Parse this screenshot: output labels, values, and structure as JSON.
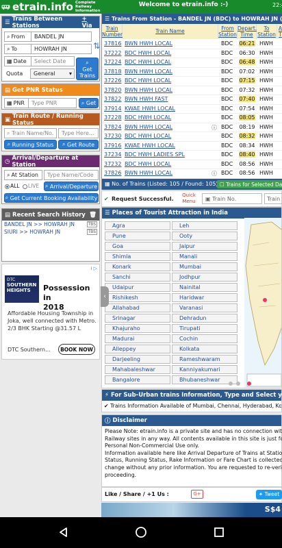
{
  "header": {
    "logo_text": "etrain.info",
    "tagline": "Complete Railway Information",
    "welcome": "Welcome to etrain.info :-)",
    "clock": "22:4"
  },
  "between_stations": {
    "title": "Trains Between Stations",
    "via": "+ Via",
    "from_label": "From",
    "from_value": "BANDEL JN",
    "to_label": "To",
    "to_value": "HOWRAH JN",
    "date_label": "Date",
    "date_placeholder": "Select Date",
    "quota_label": "Quota",
    "quota_value": "General",
    "get_trains": "Get Trains"
  },
  "pnr": {
    "title": "Get PNR Status",
    "label": "PNR",
    "placeholder": "Type PNR",
    "button": "Get"
  },
  "route": {
    "title": "Train Route / Running Status",
    "placeholder_1": "Train Name/No.",
    "placeholder_2": "Type Here...",
    "running_btn": "Running Status",
    "route_btn": "Get Route"
  },
  "arrdep": {
    "title": "Arrival/Departure at Station",
    "station_label": "At Station",
    "station_placeholder": "Type Name/Code",
    "radio_all": "ALL",
    "radio_live": "LIVE",
    "arrdep_btn": "Arrival/Departure",
    "booking_btn": "Get Current Booking Availability"
  },
  "history": {
    "title": "Recent Search History",
    "items": [
      {
        "text": "BANDEL JN >> HOWRAH JN",
        "tag": "TBS"
      },
      {
        "text": "SIURI >> HOWRAH JN",
        "tag": "TBS"
      }
    ]
  },
  "ad": {
    "choice": "i ▷",
    "logo_line1": "DTC",
    "logo_line2": "SOUTHERN",
    "logo_line3": "HEIGHTS",
    "title_line1": "Possession in",
    "title_line2": "2018",
    "desc": "Affordable Housing Township in Joka, well connected with Metro. 2/3 BHK Starting @31.57 L",
    "source": "DTC Southern...",
    "cta": "BOOK NOW"
  },
  "trains": {
    "title": "Trains From Station - BANDEL JN (BDC) to HOWRAH JN (HWH)",
    "columns": [
      "Train Number",
      "Train Name",
      "From Station",
      "Depart. Time",
      "To Station",
      "A T"
    ],
    "rows": [
      {
        "num": "37816",
        "name": "BWN HWH LOCAL",
        "from": "BDC",
        "dep": "06:21",
        "to": "HWH",
        "hl": true,
        "info": false
      },
      {
        "num": "37222",
        "name": "BDC HWH LOCAL",
        "from": "BDC",
        "dep": "06:30",
        "to": "HWH",
        "hl": false,
        "info": false
      },
      {
        "num": "37224",
        "name": "BDC HWH LOCAL",
        "from": "BDC",
        "dep": "06:48",
        "to": "HWH",
        "hl": true,
        "info": false
      },
      {
        "num": "37818",
        "name": "BWN HWH LOCAL",
        "from": "BDC",
        "dep": "07:02",
        "to": "HWH",
        "hl": false,
        "info": false
      },
      {
        "num": "37226",
        "name": "BDC HWH LOCAL",
        "from": "BDC",
        "dep": "07:15",
        "to": "HWH",
        "hl": true,
        "info": false
      },
      {
        "num": "37820",
        "name": "BWN HWH LOCAL",
        "from": "BDC",
        "dep": "07:32",
        "to": "HWH",
        "hl": false,
        "info": false
      },
      {
        "num": "37822",
        "name": "BWN HWH FAST",
        "from": "BDC",
        "dep": "07:40",
        "to": "HWH",
        "hl": true,
        "info": false
      },
      {
        "num": "37914",
        "name": "KWAE HWH LOCAL",
        "from": "BDC",
        "dep": "07:54",
        "to": "HWH",
        "hl": false,
        "info": false
      },
      {
        "num": "37228",
        "name": "BDC HWH LOCAL",
        "from": "BDC",
        "dep": "08:05",
        "to": "HWH",
        "hl": true,
        "info": false
      },
      {
        "num": "37824",
        "name": "BWN HWH LOCAL",
        "from": "BDC",
        "dep": "08:19",
        "to": "HWH",
        "hl": false,
        "info": true
      },
      {
        "num": "37230",
        "name": "BDC HWH LOCAL",
        "from": "BDC",
        "dep": "08:32",
        "to": "HWH",
        "hl": true,
        "info": false
      },
      {
        "num": "37916",
        "name": "KWAE HWH LOCAL",
        "from": "BDC",
        "dep": "08:34",
        "to": "HWH",
        "hl": false,
        "info": false
      },
      {
        "num": "37234",
        "name": "BDC HWH LADIES SPL",
        "from": "BDC",
        "dep": "08:40",
        "to": "HWH",
        "hl": true,
        "info": false
      },
      {
        "num": "37232",
        "name": "BDC HWH LOCAL",
        "from": "BDC",
        "dep": "08:56",
        "to": "HWH",
        "hl": false,
        "info": false
      },
      {
        "num": "37826",
        "name": "BWN HWH LOCAL",
        "from": "BDC",
        "dep": "08:56",
        "to": "HWH",
        "hl": false,
        "info": true
      }
    ],
    "footer": "No. of Trains (Listed: 105 / Found: 105)",
    "selected_btn": "Trains for Selected Da"
  },
  "status": {
    "text": "Request Successful.",
    "quick_menu": "Quick Menu",
    "field_1": "Train No.",
    "field_2": "Train"
  },
  "tourist": {
    "title": "Places of Tourist Attraction in India",
    "left": [
      "Agra",
      "Pune",
      "Goa",
      "Shimla",
      "Konark",
      "Sanchi",
      "Udaipur",
      "Rishikesh",
      "Allahabad",
      "Srinagar",
      "Khajuraho",
      "Madurai",
      "Alleppey",
      "Darjeeling",
      "Mahabaleshwar",
      "Bangalore"
    ],
    "right": [
      "Leh",
      "Ooty",
      "Jaipur",
      "Manali",
      "Mumbai",
      "Jodhpur",
      "Nainital",
      "Haridwar",
      "Varanasi",
      "Dehradun",
      "Tirupati",
      "Cochin",
      "Kolkata",
      "Rameshwaram",
      "Kanniyakumari",
      "Bhubaneshwar"
    ]
  },
  "suburban": {
    "title": "For Sub-Urban trains Information, Type and Select your Sub-Urban St",
    "info": "Trains Information Available of Mumbai, Chennai, Hyderabad, Kolkata"
  },
  "disclaimer": {
    "title": "Disclaimer",
    "lines": [
      "Please Note: etrain.info is a private site and has no connection with India",
      "Railway sites in any way. All contents available in this site is just for Inform",
      "Personal Non-Commercial Use only.",
      "Information available here like Arrival Departure of Trains at Stations, Tra",
      "Status, Running Status, Rake Information or Fare Chart is collected from",
      "change without any prior information. You are requested to re-verify it fro",
      "proceeding."
    ]
  },
  "share": {
    "label": "Like / Share / +1 Us :",
    "gplus": "G+",
    "tweet": "Tweet"
  },
  "banner": {
    "text": "S$4"
  },
  "colors": {
    "green": "#188a2b",
    "blue": "#2a5a8f",
    "highlight": "#f5e47a",
    "link": "#1f4fa0"
  }
}
